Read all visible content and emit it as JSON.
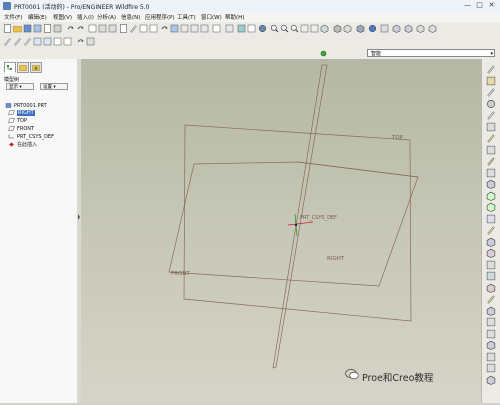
{
  "window": {
    "title": "PRT0001 (活动的) - Pro/ENGINEER Wildfire 5.0",
    "controls": [
      "—",
      "□",
      "✕"
    ]
  },
  "menu": [
    "文件(F)",
    "编辑(E)",
    "视图(V)",
    "插入(I)",
    "分析(A)",
    "信息(N)",
    "应用程序(P)",
    "工具(T)",
    "窗口(W)",
    "帮助(H)"
  ],
  "selection_filter": {
    "value": "智能"
  },
  "left_panel": {
    "tabs": [
      "model-tree-tab",
      "folder-tab",
      "favorites-tab"
    ],
    "label": "模型树",
    "dropdowns": [
      "显示 ▾",
      "设置 ▾"
    ],
    "tree": [
      {
        "label": "PRT0001.PRT",
        "icon": "part-icon",
        "selected": false
      },
      {
        "label": "RIGHT",
        "icon": "datum-plane-icon",
        "selected": true
      },
      {
        "label": "TOP",
        "icon": "datum-plane-icon",
        "selected": false
      },
      {
        "label": "FRONT",
        "icon": "datum-plane-icon",
        "selected": false
      },
      {
        "label": "PRT_CSYS_DEF",
        "icon": "csys-icon",
        "selected": false
      },
      {
        "label": "在此插入",
        "icon": "insert-here-icon",
        "selected": false
      }
    ]
  },
  "canvas": {
    "plane_labels": {
      "top": "TOP",
      "right": "RIGHT",
      "front": "FRONT"
    },
    "csys_label": "PRT_CSYS_DEF",
    "plane_color": "#8a6a5a"
  },
  "watermark": {
    "text": "Proe和Creo教程"
  },
  "colors": {
    "selection": "#3a6fc4",
    "canvas_top": "#b4b8a4",
    "canvas_bottom": "#d6d4c8"
  }
}
